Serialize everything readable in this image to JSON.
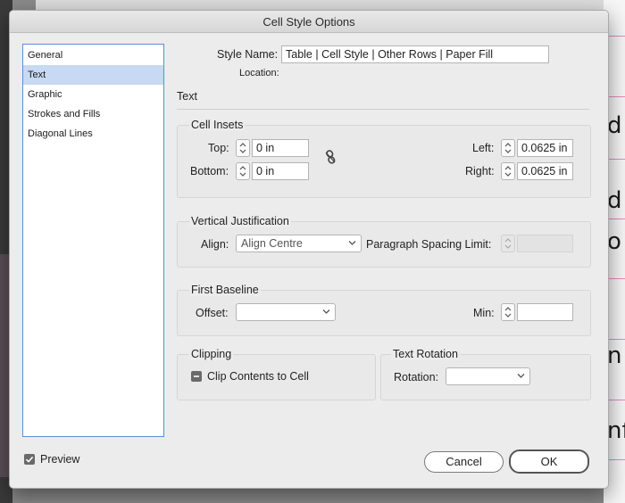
{
  "background": {
    "letters": [
      "d",
      "d",
      "o",
      "n",
      "nf"
    ]
  },
  "dialog": {
    "title": "Cell Style Options"
  },
  "sidebar": {
    "items": [
      {
        "label": "General"
      },
      {
        "label": "Text"
      },
      {
        "label": "Graphic"
      },
      {
        "label": "Strokes and Fills"
      },
      {
        "label": "Diagonal Lines"
      }
    ],
    "selected": "Text"
  },
  "style_name": {
    "label": "Style Name:",
    "value": "Table | Cell Style | Other Rows | Paper Fill",
    "location_label": "Location:"
  },
  "section_title": "Text",
  "cell_insets": {
    "title": "Cell Insets",
    "top_label": "Top:",
    "top_value": "0 in",
    "bottom_label": "Bottom:",
    "bottom_value": "0 in",
    "left_label": "Left:",
    "left_value": "0.0625 in",
    "right_label": "Right:",
    "right_value": "0.0625 in",
    "link_icon": "broken-chain-icon"
  },
  "vertical_justification": {
    "title": "Vertical Justification",
    "align_label": "Align:",
    "align_value": "Align Centre",
    "spacing_label": "Paragraph Spacing Limit:",
    "spacing_value": ""
  },
  "first_baseline": {
    "title": "First Baseline",
    "offset_label": "Offset:",
    "offset_value": "",
    "min_label": "Min:",
    "min_value": ""
  },
  "clipping": {
    "title": "Clipping",
    "checkbox_label": "Clip Contents to Cell",
    "state": "mixed"
  },
  "text_rotation": {
    "title": "Text Rotation",
    "rotation_label": "Rotation:",
    "rotation_value": ""
  },
  "footer": {
    "preview_label": "Preview",
    "preview_checked": true,
    "cancel_label": "Cancel",
    "ok_label": "OK"
  },
  "colors": {
    "selection": "#c7d9f3",
    "sidebar_border": "#5a8fd6",
    "page_guides": "#e48bc0"
  }
}
